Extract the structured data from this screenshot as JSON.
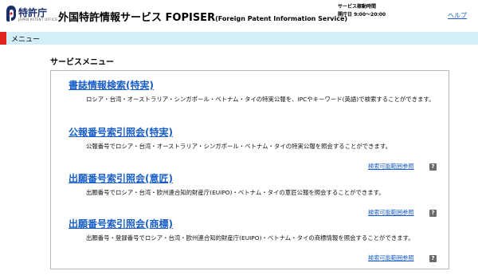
{
  "header": {
    "logo_text": "特許庁",
    "logo_sub": "JAPAN PATENT OFFICE",
    "title_main": "外国特許情報サービス FOPISER",
    "title_sub": "(Foreign Patent Information Service)",
    "hours_label": "サービス稼動時間",
    "hours_value": "開庁日 9:00〜20:00",
    "help_label": "ヘルプ"
  },
  "menu_bar": {
    "label": "メニュー"
  },
  "service_menu": {
    "title": "サービスメニュー",
    "items": [
      {
        "title": "書誌情報検索(特実)",
        "desc": "ロシア・台湾・オーストラリア・シンガポール・ベトナム・タイの特実公報を、IPCやキーワード(英語)で検索することができます。"
      },
      {
        "title": "公報番号索引照会(特実)",
        "desc": "公報番号でロシア・台湾・オーストラリア・シンガポール・ベトナム・タイの特実公報を照会することができます。",
        "ref_label": "検索可能範囲参照",
        "ref_icon": "?"
      },
      {
        "title": "出願番号索引照会(意匠)",
        "desc": "出願番号でロシア・台湾・欧州連合知的財産庁(EUIPO)・ベトナム・タイの意匠公報を照会することができます。",
        "ref_label": "検索可能範囲参照",
        "ref_icon": "?"
      },
      {
        "title": "出願番号索引照会(商標)",
        "desc": "出願番号・登録番号でロシア・台湾・欧州連合知的財産庁(EUIPO)・ベトナム・タイの商標情報を照会することができます。",
        "ref_label": "検索可能範囲参照",
        "ref_icon": "?"
      }
    ]
  },
  "colors": {
    "link": "#1a5fc8",
    "menu_bar_bg": "#d4eef8",
    "menu_accent": "#e0251c",
    "logo": "#1a2e6b"
  },
  "icons": {
    "logo": "jpo-logo-icon",
    "help": "question-icon"
  }
}
